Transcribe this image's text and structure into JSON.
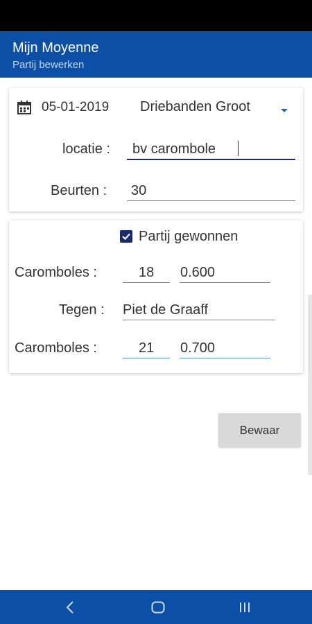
{
  "app": {
    "title": "Mijn Moyenne",
    "subtitle": "Partij bewerken",
    "colors": {
      "primary": "#0b4fa6",
      "accent": "#1a2a6e",
      "underline": "#5b8fd6"
    }
  },
  "card1": {
    "date": "05-01-2019",
    "date_icon": "calendar-icon",
    "discipline": "Driebanden Groot",
    "dropdown_icon": "dropdown-arrow-icon",
    "location_label": "locatie :",
    "location_value": "bv carombole",
    "turns_label": "Beurten :",
    "turns_value": "30"
  },
  "card2": {
    "won_label": "Partij gewonnen",
    "won_checked": true,
    "player_caroms_label": "Caromboles :",
    "player_caroms": "18",
    "player_avg": "0.600",
    "opponent_label": "Tegen :",
    "opponent_name": "Piet de Graaff",
    "opponent_caroms_label": "Caromboles :",
    "opponent_caroms": "21",
    "opponent_avg": "0.700"
  },
  "actions": {
    "save_label": "Bewaar"
  },
  "navbar": {
    "back_icon": "back-icon",
    "home_icon": "home-icon",
    "recents_icon": "recents-icon"
  }
}
